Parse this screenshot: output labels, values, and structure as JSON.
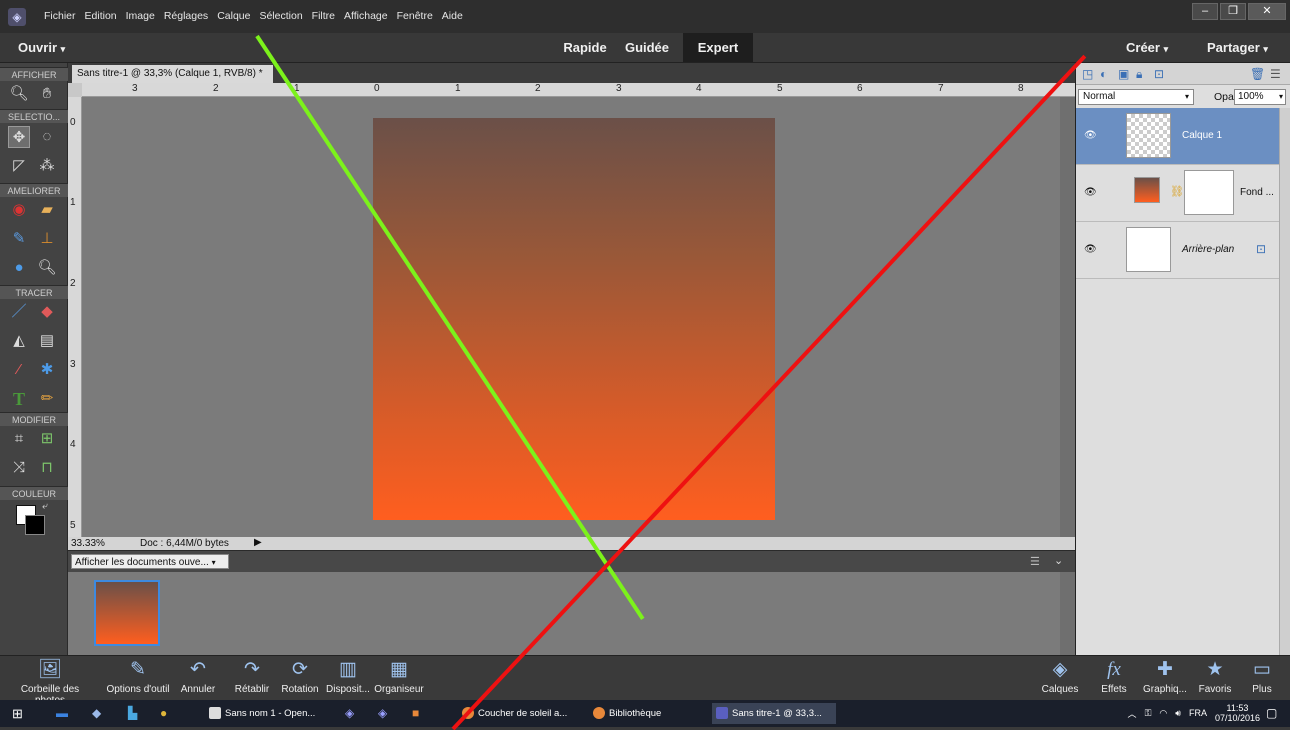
{
  "menubar": {
    "logo_icon": "photoshop-elements-logo-icon",
    "items": [
      "Fichier",
      "Edition",
      "Image",
      "Réglages",
      "Calque",
      "Sélection",
      "Filtre",
      "Affichage",
      "Fenêtre",
      "Aide"
    ],
    "window_buttons": [
      "–",
      "❐",
      "✕"
    ]
  },
  "modebar": {
    "open_label": "Ouvrir",
    "modes": [
      "Rapide",
      "Guidée",
      "Expert"
    ],
    "active_mode": "Expert",
    "create_label": "Créer",
    "share_label": "Partager"
  },
  "toolbox": {
    "sections": [
      "AFFICHER",
      "SELECTIO...",
      "AMELIORER",
      "TRACER",
      "MODIFIER",
      "COULEUR"
    ]
  },
  "document": {
    "tab_title": "Sans titre-1 @ 33,3% (Calque 1, RVB/8) *",
    "ruler_h": [
      "3",
      "2",
      "1",
      "0",
      "1",
      "2",
      "3",
      "4",
      "5",
      "6",
      "7",
      "8"
    ],
    "ruler_v": [
      "0",
      "1",
      "2",
      "3",
      "4",
      "5"
    ],
    "zoom": "33.33%",
    "doc_info": "Doc : 6,44M/0 bytes"
  },
  "bin": {
    "select_label": "Afficher les documents ouve..."
  },
  "layers": {
    "blend_mode": "Normal",
    "opacity_label": "Opacité :",
    "opacity_value": "100%",
    "items": [
      {
        "name": "Calque 1",
        "selected": true
      },
      {
        "name": "Fond ...",
        "selected": false
      },
      {
        "name": "Arrière-plan",
        "selected": false
      }
    ]
  },
  "bottombar": {
    "left": [
      "Corbeille des photos",
      "Options d'outil",
      "Annuler",
      "Rétablir",
      "Rotation",
      "Disposit...",
      "Organiseur"
    ],
    "right": [
      "Calques",
      "Effets",
      "Graphiq...",
      "Favoris",
      "Plus"
    ]
  },
  "taskbar": {
    "tasks": [
      "Sans nom 1 - Open...",
      "Coucher de soleil a...",
      "Bibliothèque",
      "Sans titre-1 @ 33,3..."
    ],
    "lang": "FRA",
    "time": "11:53",
    "date": "07/10/2016"
  },
  "colors": {
    "accent": "#3d8ae0",
    "overlay_green": "#7cf21b",
    "overlay_red": "#ee1111"
  }
}
